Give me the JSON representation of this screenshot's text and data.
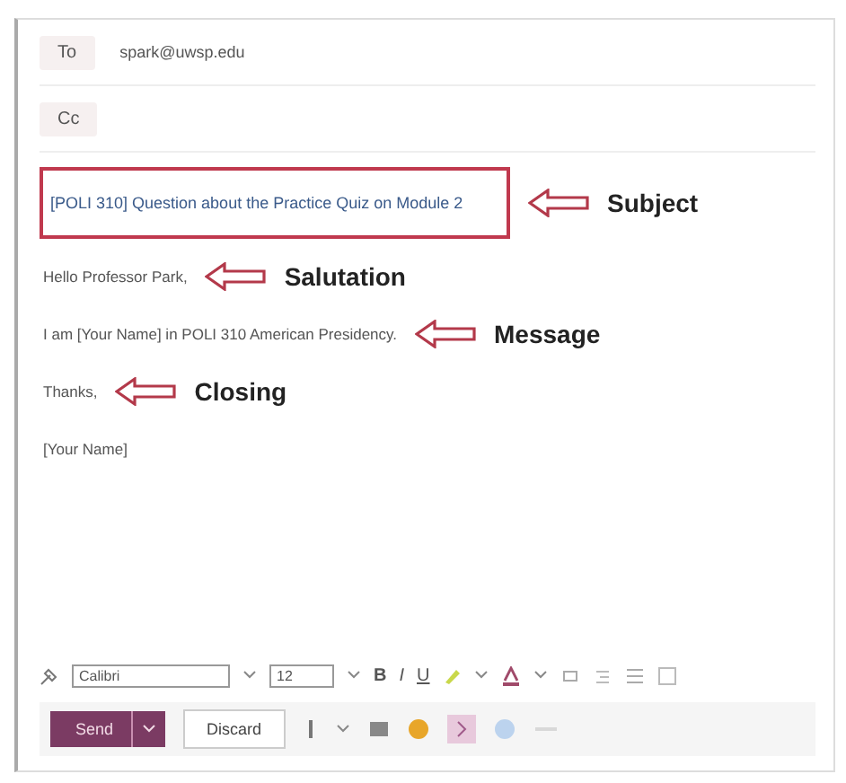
{
  "to": {
    "label": "To",
    "value": "spark@uwsp.edu"
  },
  "cc": {
    "label": "Cc"
  },
  "subject": {
    "value": "[POLI 310] Question about the Practice Quiz on Module 2",
    "annotation": "Subject"
  },
  "body": [
    {
      "text": "Hello Professor Park,",
      "annotation": "Salutation"
    },
    {
      "text": "I am [Your Name] in POLI 310 American Presidency.",
      "annotation": "Message"
    },
    {
      "text": "Thanks,",
      "annotation": "Closing"
    },
    {
      "text": "[Your Name]"
    }
  ],
  "format_toolbar": {
    "font": "Calibri",
    "size": "12",
    "bold": "B",
    "italic": "I",
    "underline": "U"
  },
  "actions": {
    "send": "Send",
    "discard": "Discard"
  }
}
